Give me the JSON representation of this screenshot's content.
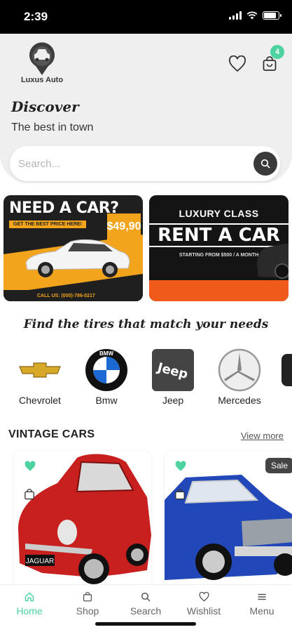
{
  "status_bar": {
    "time": "2:39"
  },
  "header": {
    "brand_name": "Luxus Auto",
    "discover_title": "Discover",
    "discover_subtitle": "The best in town",
    "cart_count": "4"
  },
  "search": {
    "placeholder": "Search..."
  },
  "banners": [
    {
      "headline": "NEED A CAR?",
      "subline": "GET THE BEST PRICE HERE!",
      "price": "$49,90",
      "footer": "CALL US: (000)-786-0217"
    },
    {
      "headline": "LUXURY CLASS",
      "big": "RENT A CAR",
      "small": "STARTING FROM $500 / A MONTH"
    }
  ],
  "tires_section": {
    "title": "Find the tires that match your needs"
  },
  "brands": [
    {
      "name": "Chevrolet",
      "icon": "chevrolet-logo-icon"
    },
    {
      "name": "Bmw",
      "icon": "bmw-logo-icon"
    },
    {
      "name": "Jeep",
      "icon": "jeep-logo-icon"
    },
    {
      "name": "Mercedes",
      "icon": "mercedes-logo-icon"
    }
  ],
  "vintage": {
    "title": "VINTAGE CARS",
    "view_more": "View more",
    "products": [
      {
        "image": "red-jaguar-car",
        "plate": "JAGUAR"
      },
      {
        "image": "blue-vintage-car",
        "badge": "Sale"
      }
    ]
  },
  "tabs": [
    {
      "label": "Home",
      "icon": "home-icon",
      "active": true
    },
    {
      "label": "Shop",
      "icon": "bag-icon",
      "active": false
    },
    {
      "label": "Search",
      "icon": "search-icon",
      "active": false
    },
    {
      "label": "Wishlist",
      "icon": "heart-icon",
      "active": false
    },
    {
      "label": "Menu",
      "icon": "menu-icon",
      "active": false
    }
  ],
  "colors": {
    "accent": "#4cd3a0",
    "header_bg": "#efefef",
    "banner_orange": "#f2a51c",
    "rent_orange": "#f05a1a"
  }
}
